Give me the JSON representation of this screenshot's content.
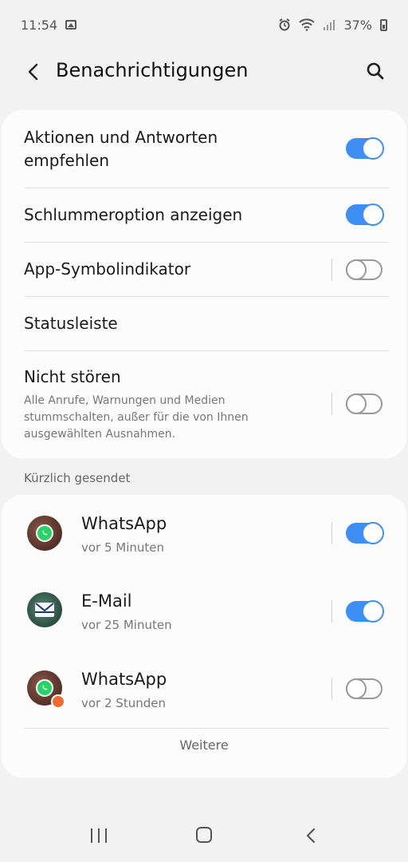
{
  "status_bar": {
    "time": "11:54",
    "battery": "37%"
  },
  "header": {
    "title": "Benachrichtigungen"
  },
  "settings": [
    {
      "label_line1": "Aktionen und Antworten",
      "label_line2": "empfehlen",
      "toggle": "on"
    },
    {
      "label": "Schlummeroption anzeigen",
      "toggle": "on"
    },
    {
      "label": "App-Symbolindikator",
      "toggle": "off"
    },
    {
      "label": "Statusleiste"
    },
    {
      "label": "Nicht stören",
      "sub_line1": "Alle Anrufe, Warnungen und Medien",
      "sub_line2": "stummschalten, außer für die von Ihnen",
      "sub_line3": "ausgewählten Ausnahmen.",
      "toggle": "off"
    }
  ],
  "recent": {
    "section_title": "Kürzlich gesendet",
    "items": [
      {
        "app": "WhatsApp",
        "time": "vor 5 Minuten",
        "toggle": "on",
        "icon": "whatsapp-icon"
      },
      {
        "app": "E-Mail",
        "time": "vor 25 Minuten",
        "toggle": "on",
        "icon": "email-icon"
      },
      {
        "app": "WhatsApp",
        "time": "vor 2 Stunden",
        "toggle": "off",
        "icon": "whatsapp-icon"
      }
    ],
    "more_label": "Weitere"
  },
  "colors": {
    "accent": "#3d8ef5",
    "background": "#f2f2f2",
    "card": "#fcfcfc"
  }
}
